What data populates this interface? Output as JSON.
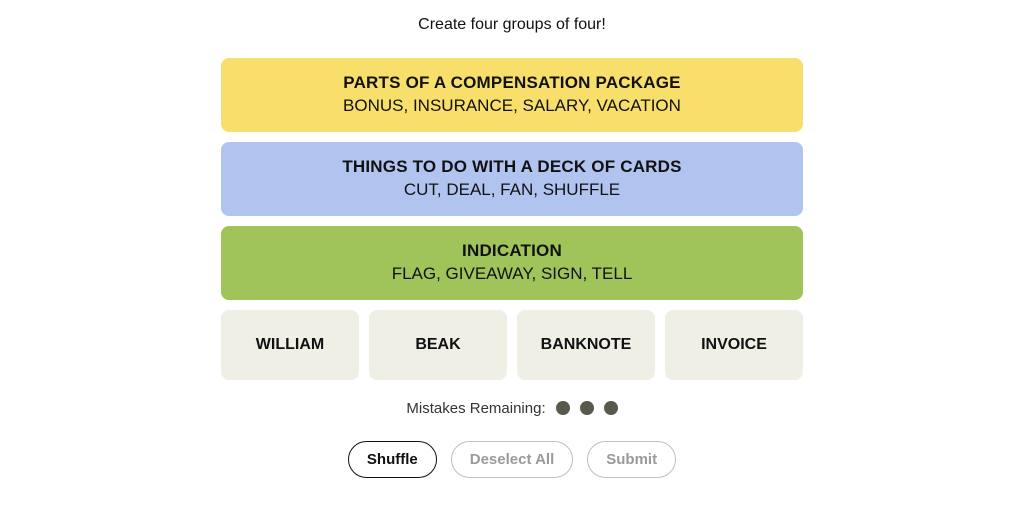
{
  "instructions": "Create four groups of four!",
  "solved": [
    {
      "color": "yellow",
      "category": "PARTS OF A COMPENSATION PACKAGE",
      "words": "BONUS, INSURANCE, SALARY, VACATION"
    },
    {
      "color": "blue",
      "category": "THINGS TO DO WITH A DECK OF CARDS",
      "words": "CUT, DEAL, FAN, SHUFFLE"
    },
    {
      "color": "green",
      "category": "INDICATION",
      "words": "FLAG, GIVEAWAY, SIGN, TELL"
    }
  ],
  "tiles": [
    "WILLIAM",
    "BEAK",
    "BANKNOTE",
    "INVOICE"
  ],
  "mistakes": {
    "label": "Mistakes Remaining:",
    "remaining": 3
  },
  "buttons": {
    "shuffle": {
      "label": "Shuffle",
      "enabled": true
    },
    "deselect": {
      "label": "Deselect All",
      "enabled": false
    },
    "submit": {
      "label": "Submit",
      "enabled": false
    }
  },
  "colors": {
    "yellow": "#f8df6b",
    "blue": "#b0c4ef",
    "green": "#a0c35a",
    "tile": "#efefe6",
    "dot": "#5a594e"
  }
}
